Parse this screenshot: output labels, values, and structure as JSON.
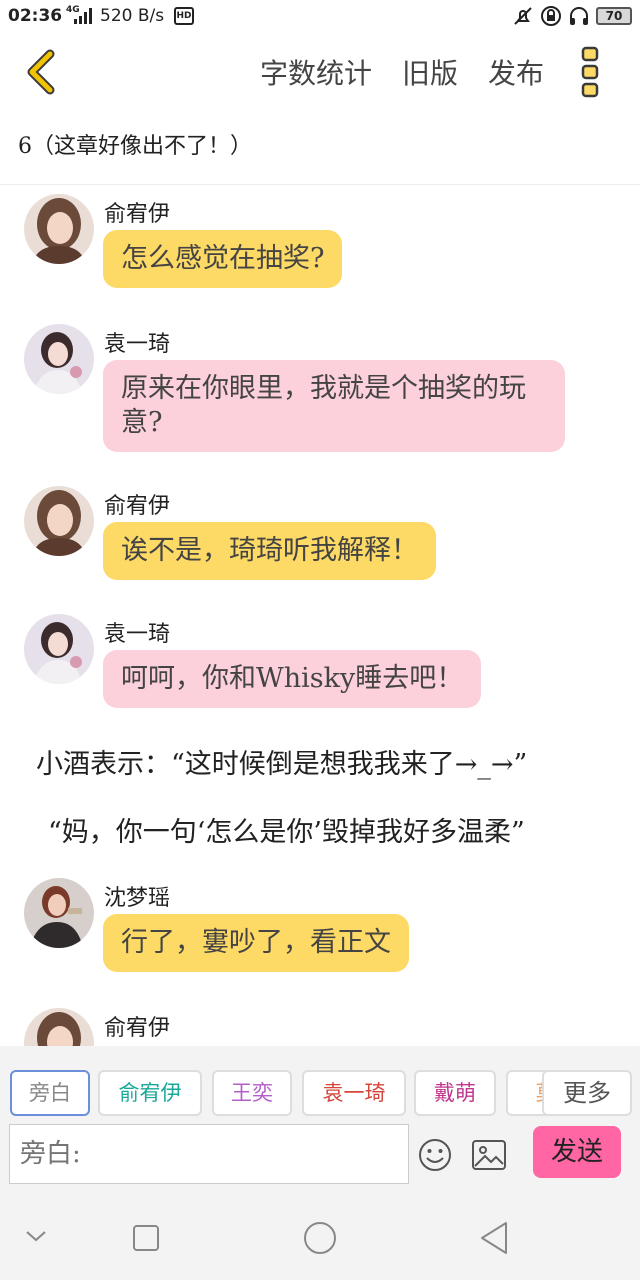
{
  "status_bar": {
    "time": "02:36",
    "network": "4G",
    "speed": "520 B/s",
    "hd": "HD",
    "battery": "70"
  },
  "nav": {
    "links": [
      "字数统计",
      "旧版",
      "发布"
    ]
  },
  "chapter_title": "6（这章好像出不了！）",
  "messages": [
    {
      "speaker": "俞宥伊",
      "text": "怎么感觉在抽奖?",
      "color": "yellow"
    },
    {
      "speaker": "袁一琦",
      "text": "原来在你眼里，我就是个抽奖的玩意?",
      "color": "pink"
    },
    {
      "speaker": "俞宥伊",
      "text": "诶不是，琦琦听我解释！",
      "color": "yellow"
    },
    {
      "speaker": "袁一琦",
      "text": "呵呵，你和Whisky睡去吧！",
      "color": "pink"
    },
    {
      "speaker": "沈梦瑶",
      "text": "行了，寠吵了，看正文",
      "color": "yellow"
    },
    {
      "speaker": "俞宥伊"
    }
  ],
  "narration": [
    "小酒表示：“这时候倒是想我我来了→_→”",
    "“妈，你一句‘怎么是你’毁掉我好多温柔”"
  ],
  "roles": [
    {
      "name": "旁白",
      "color": "#888888"
    },
    {
      "name": "俞宥伊",
      "color": "#1aa89a"
    },
    {
      "name": "王奕",
      "color": "#b45cc8"
    },
    {
      "name": "袁一琦",
      "color": "#d6453b"
    },
    {
      "name": "戴萌",
      "color": "#c2378e"
    },
    {
      "name": "莫",
      "color": "#f0a060"
    }
  ],
  "more_label": "更多",
  "input_placeholder": "旁白:",
  "send_label": "发送",
  "colors": {
    "yellow_bubble": "#fdd966",
    "pink_bubble": "#fcd1dc",
    "send_button": "#ff66a3",
    "back_icon": "#f2c300"
  },
  "icons": [
    "back-icon",
    "more-vertical-icon",
    "emoji-icon",
    "image-icon",
    "nav-back-icon",
    "nav-home-icon",
    "nav-recent-icon",
    "nav-collapse-icon"
  ]
}
